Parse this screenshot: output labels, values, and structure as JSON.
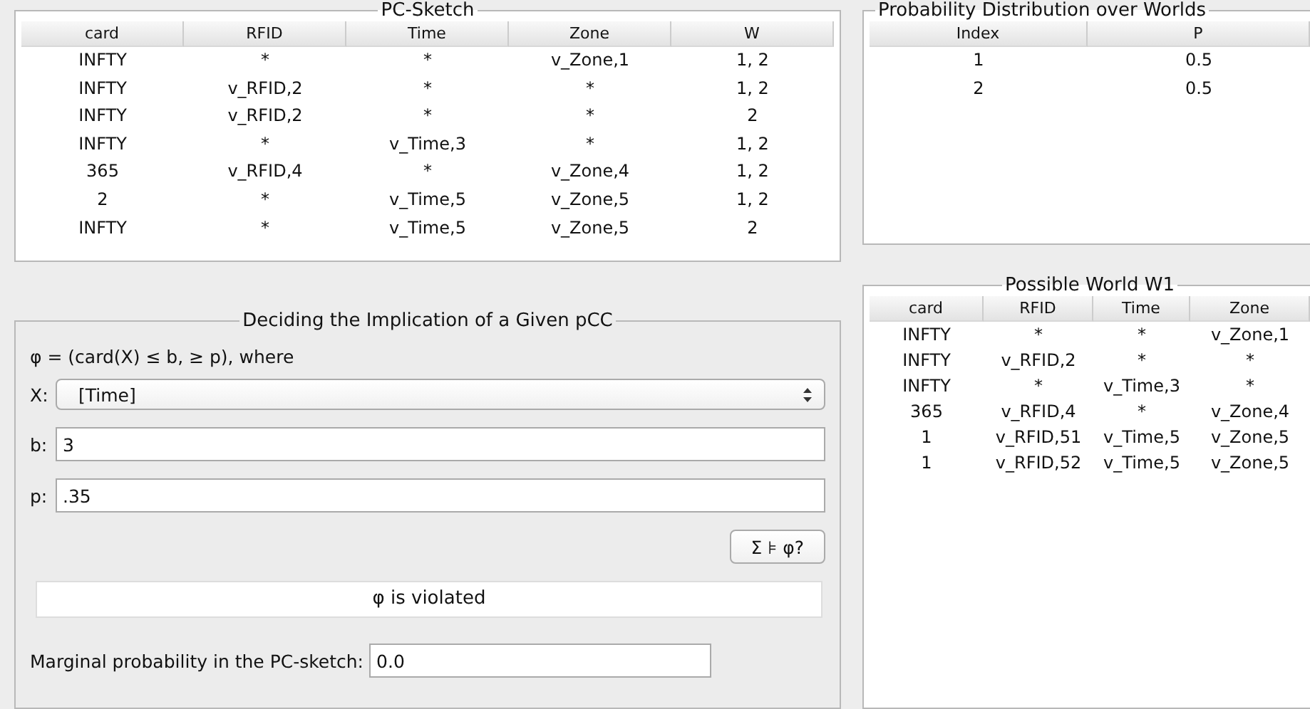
{
  "pc_sketch": {
    "title": "PC-Sketch",
    "columns": [
      "card",
      "RFID",
      "Time",
      "Zone",
      "W"
    ],
    "rows": [
      [
        "INFTY",
        "*",
        "*",
        "v_Zone,1",
        "1, 2"
      ],
      [
        "INFTY",
        "v_RFID,2",
        "*",
        "*",
        "1, 2"
      ],
      [
        "INFTY",
        "v_RFID,2",
        "*",
        "*",
        "2"
      ],
      [
        "INFTY",
        "*",
        "v_Time,3",
        "*",
        "1, 2"
      ],
      [
        "365",
        "v_RFID,4",
        "*",
        "v_Zone,4",
        "1, 2"
      ],
      [
        "2",
        "*",
        "v_Time,5",
        "v_Zone,5",
        "1, 2"
      ],
      [
        "INFTY",
        "*",
        "v_Time,5",
        "v_Zone,5",
        "2"
      ]
    ]
  },
  "distribution": {
    "title": "Probability Distribution over Worlds",
    "columns": [
      "Index",
      "P"
    ],
    "rows": [
      [
        "1",
        "0.5"
      ],
      [
        "2",
        "0.5"
      ]
    ]
  },
  "implication": {
    "title": "Deciding the Implication of a Given pCC",
    "formula": "φ = (card(X) ≤ b, ≥ p), where",
    "x_label": "X:",
    "x_value": "[Time]",
    "b_label": "b:",
    "b_value": "3",
    "p_label": "p:",
    "p_value": ".35",
    "button": "Σ ⊧ φ?",
    "result": "φ is violated",
    "marginal_label": "Marginal probability in the PC-sketch:",
    "marginal_value": "0.0"
  },
  "possible_world": {
    "title": "Possible World W1",
    "columns": [
      "card",
      "RFID",
      "Time",
      "Zone"
    ],
    "rows": [
      [
        "INFTY",
        "*",
        "*",
        "v_Zone,1"
      ],
      [
        "INFTY",
        "v_RFID,2",
        "*",
        "*"
      ],
      [
        "INFTY",
        "*",
        "v_Time,3",
        "*"
      ],
      [
        "365",
        "v_RFID,4",
        "*",
        "v_Zone,4"
      ],
      [
        "1",
        "v_RFID,51",
        "v_Time,5",
        "v_Zone,5"
      ],
      [
        "1",
        "v_RFID,52",
        "v_Time,5",
        "v_Zone,5"
      ]
    ]
  }
}
